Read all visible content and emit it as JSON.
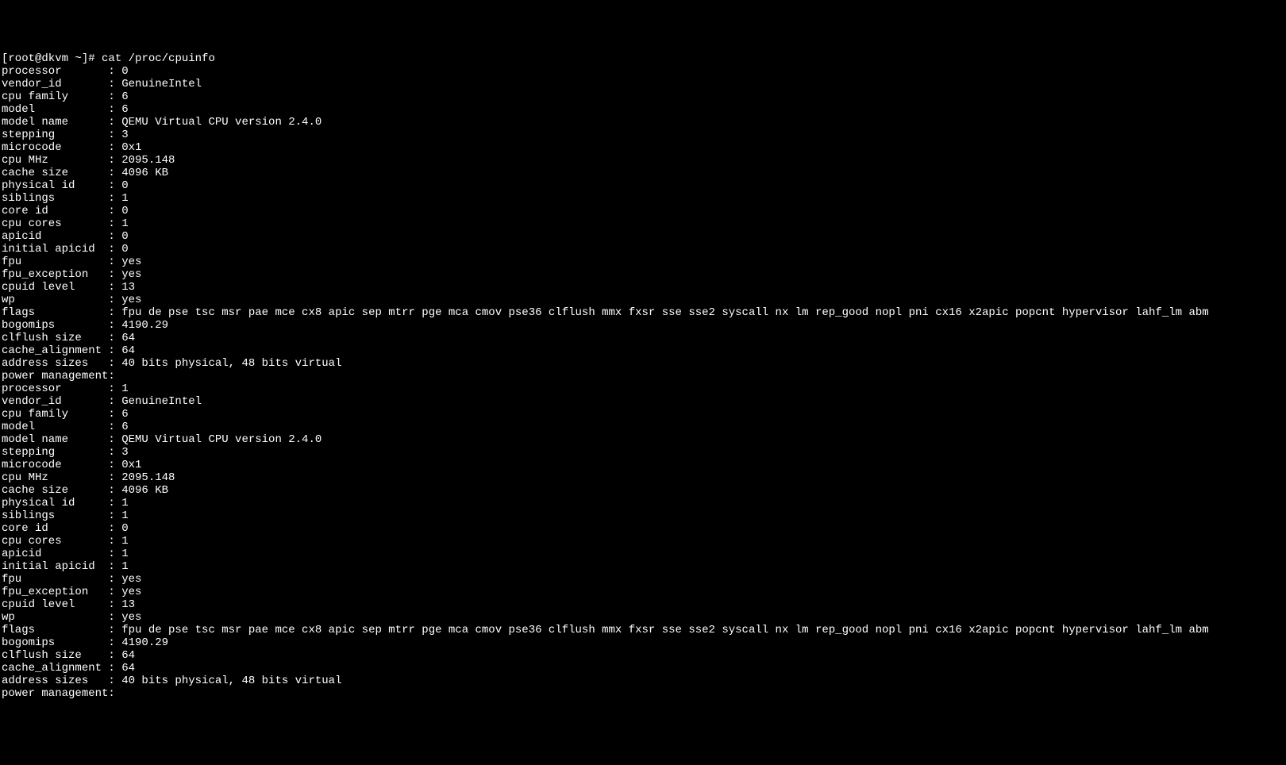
{
  "prompt": "[root@dkvm ~]# ",
  "command": "cat /proc/cpuinfo",
  "cpus": [
    {
      "fields": [
        {
          "key": "processor",
          "value": "0"
        },
        {
          "key": "vendor_id",
          "value": "GenuineIntel"
        },
        {
          "key": "cpu family",
          "value": "6"
        },
        {
          "key": "model",
          "value": "6"
        },
        {
          "key": "model name",
          "value": "QEMU Virtual CPU version 2.4.0"
        },
        {
          "key": "stepping",
          "value": "3"
        },
        {
          "key": "microcode",
          "value": "0x1"
        },
        {
          "key": "cpu MHz",
          "value": "2095.148"
        },
        {
          "key": "cache size",
          "value": "4096 KB"
        },
        {
          "key": "physical id",
          "value": "0"
        },
        {
          "key": "siblings",
          "value": "1"
        },
        {
          "key": "core id",
          "value": "0"
        },
        {
          "key": "cpu cores",
          "value": "1"
        },
        {
          "key": "apicid",
          "value": "0"
        },
        {
          "key": "initial apicid",
          "value": "0"
        },
        {
          "key": "fpu",
          "value": "yes"
        },
        {
          "key": "fpu_exception",
          "value": "yes"
        },
        {
          "key": "cpuid level",
          "value": "13"
        },
        {
          "key": "wp",
          "value": "yes"
        },
        {
          "key": "flags",
          "value": "fpu de pse tsc msr pae mce cx8 apic sep mtrr pge mca cmov pse36 clflush mmx fxsr sse sse2 syscall nx lm rep_good nopl pni cx16 x2apic popcnt hypervisor lahf_lm abm"
        },
        {
          "key": "bogomips",
          "value": "4190.29"
        },
        {
          "key": "clflush size",
          "value": "64"
        },
        {
          "key": "cache_alignment",
          "value": "64"
        },
        {
          "key": "address sizes",
          "value": "40 bits physical, 48 bits virtual"
        },
        {
          "key": "power management",
          "value": ""
        }
      ]
    },
    {
      "fields": [
        {
          "key": "processor",
          "value": "1"
        },
        {
          "key": "vendor_id",
          "value": "GenuineIntel"
        },
        {
          "key": "cpu family",
          "value": "6"
        },
        {
          "key": "model",
          "value": "6"
        },
        {
          "key": "model name",
          "value": "QEMU Virtual CPU version 2.4.0"
        },
        {
          "key": "stepping",
          "value": "3"
        },
        {
          "key": "microcode",
          "value": "0x1"
        },
        {
          "key": "cpu MHz",
          "value": "2095.148"
        },
        {
          "key": "cache size",
          "value": "4096 KB"
        },
        {
          "key": "physical id",
          "value": "1"
        },
        {
          "key": "siblings",
          "value": "1"
        },
        {
          "key": "core id",
          "value": "0"
        },
        {
          "key": "cpu cores",
          "value": "1"
        },
        {
          "key": "apicid",
          "value": "1"
        },
        {
          "key": "initial apicid",
          "value": "1"
        },
        {
          "key": "fpu",
          "value": "yes"
        },
        {
          "key": "fpu_exception",
          "value": "yes"
        },
        {
          "key": "cpuid level",
          "value": "13"
        },
        {
          "key": "wp",
          "value": "yes"
        },
        {
          "key": "flags",
          "value": "fpu de pse tsc msr pae mce cx8 apic sep mtrr pge mca cmov pse36 clflush mmx fxsr sse sse2 syscall nx lm rep_good nopl pni cx16 x2apic popcnt hypervisor lahf_lm abm"
        },
        {
          "key": "bogomips",
          "value": "4190.29"
        },
        {
          "key": "clflush size",
          "value": "64"
        },
        {
          "key": "cache_alignment",
          "value": "64"
        },
        {
          "key": "address sizes",
          "value": "40 bits physical, 48 bits virtual"
        },
        {
          "key": "power management",
          "value": ""
        }
      ]
    }
  ],
  "field_width": 16
}
